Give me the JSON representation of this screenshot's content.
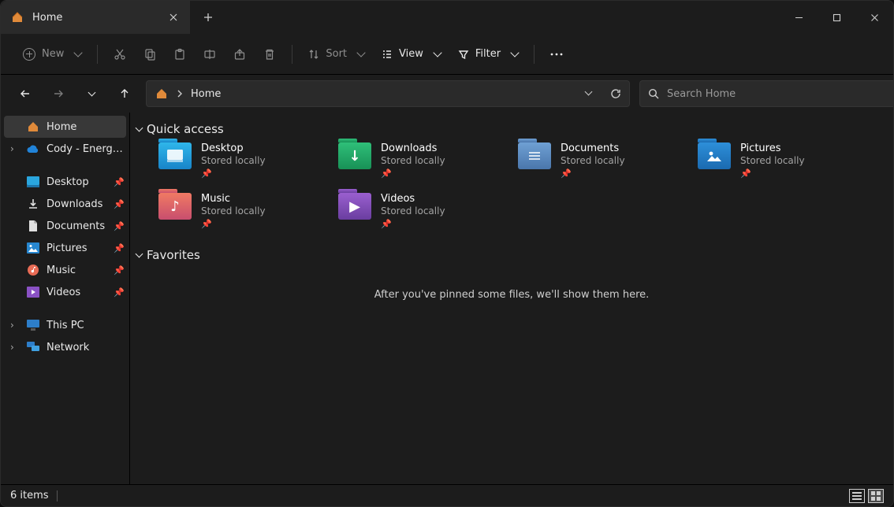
{
  "window": {
    "tab_title": "Home",
    "tooltip": ""
  },
  "toolbar": {
    "new_label": "New",
    "sort_label": "Sort",
    "view_label": "View",
    "filter_label": "Filter"
  },
  "address": {
    "location": "Home"
  },
  "search": {
    "placeholder": "Search Home"
  },
  "sidebar": {
    "root": [
      {
        "label": "Home",
        "expandable": false
      },
      {
        "label": "Cody - Energy Management",
        "expandable": true
      }
    ],
    "quick": [
      {
        "label": "Desktop"
      },
      {
        "label": "Downloads"
      },
      {
        "label": "Documents"
      },
      {
        "label": "Pictures"
      },
      {
        "label": "Music"
      },
      {
        "label": "Videos"
      }
    ],
    "system": [
      {
        "label": "This PC"
      },
      {
        "label": "Network"
      }
    ]
  },
  "sections": {
    "quick_access_title": "Quick access",
    "favorites_title": "Favorites",
    "favorites_empty": "After you've pinned some files, we'll show them here."
  },
  "quick_access": [
    {
      "name": "Desktop",
      "sub": "Stored locally"
    },
    {
      "name": "Downloads",
      "sub": "Stored locally"
    },
    {
      "name": "Documents",
      "sub": "Stored locally"
    },
    {
      "name": "Pictures",
      "sub": "Stored locally"
    },
    {
      "name": "Music",
      "sub": "Stored locally"
    },
    {
      "name": "Videos",
      "sub": "Stored locally"
    }
  ],
  "status": {
    "count_label": "6 items"
  }
}
